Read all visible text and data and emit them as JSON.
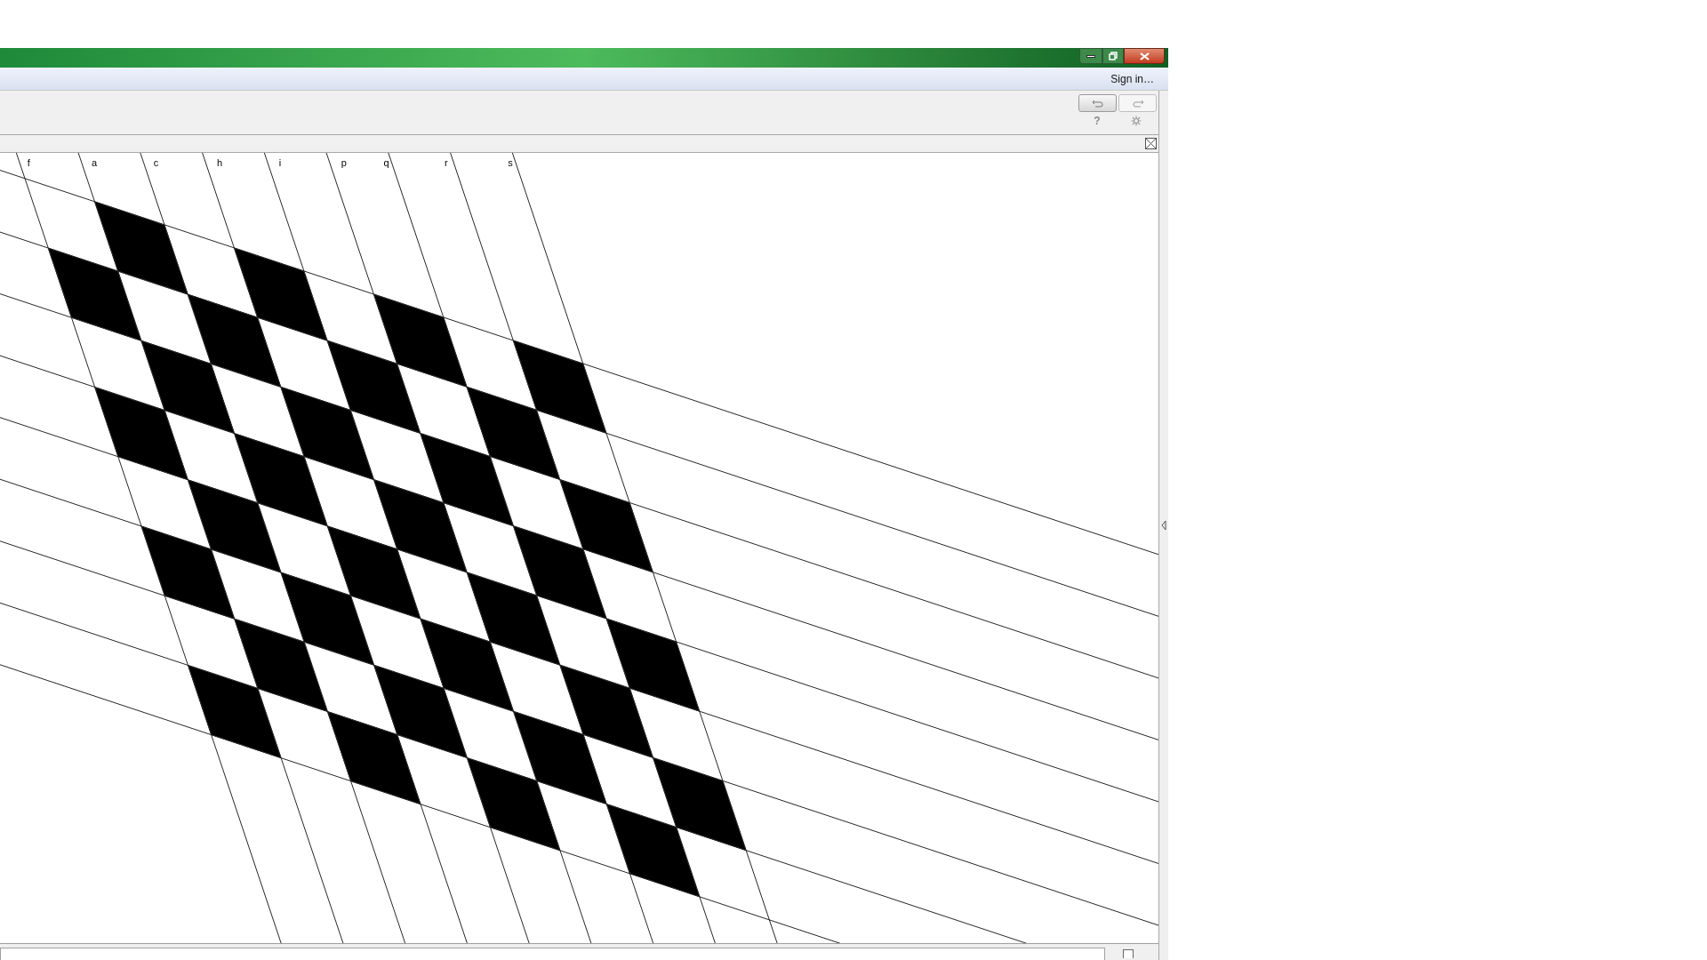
{
  "menu_bar": {
    "sign_in": "Sign in…"
  },
  "toolbar": {
    "help": "?"
  },
  "graphics": {
    "line_labels": [
      "f",
      "a",
      "c",
      "h",
      "i",
      "p",
      "q",
      "r",
      "s"
    ]
  }
}
